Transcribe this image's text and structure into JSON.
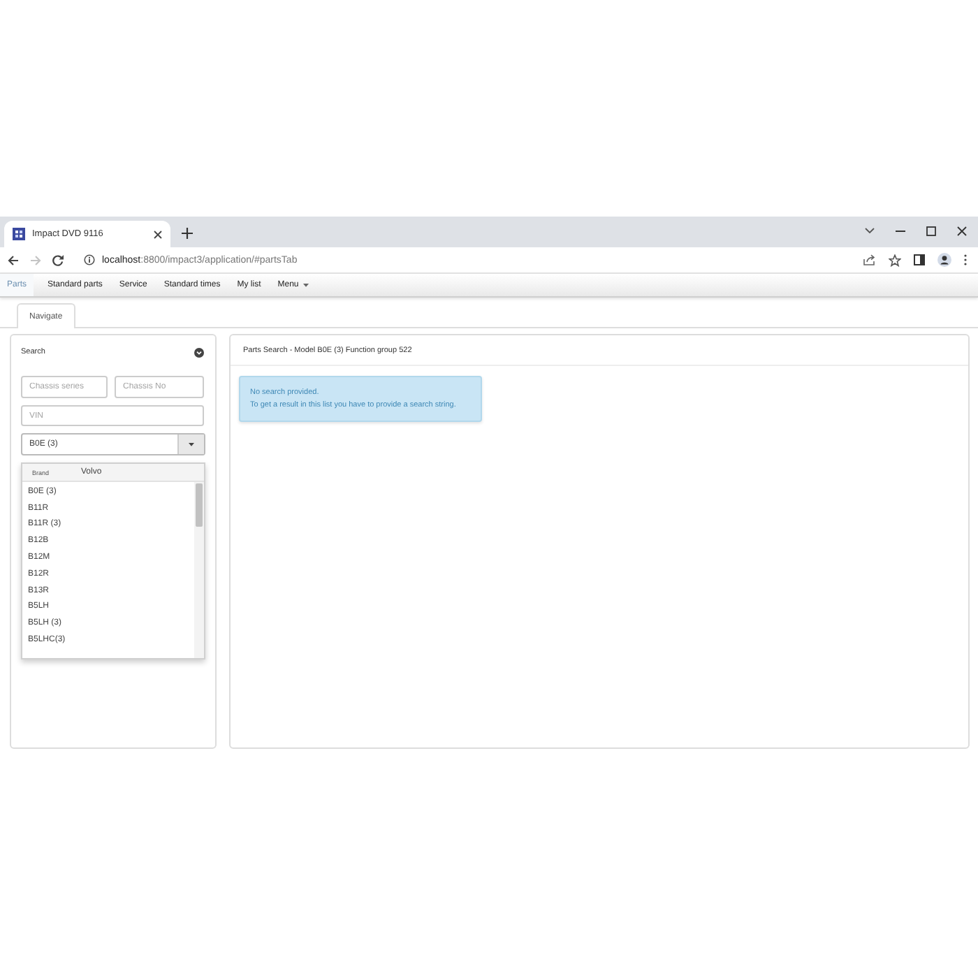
{
  "browser": {
    "tabs": [
      {
        "title": "Impact DVD 9116",
        "selected": true
      }
    ],
    "nav_buttons": [
      {
        "kind": "back",
        "disabled": false
      },
      {
        "kind": "forward",
        "disabled": true
      },
      {
        "kind": "reload",
        "disabled": false
      }
    ],
    "url": {
      "host": "localhost",
      "rest": ":8800/impact3/application/#partsTab"
    }
  },
  "app_nav": {
    "tabs": [
      {
        "label": "Parts",
        "kind": "tab",
        "selected": true
      },
      {
        "label": "Standard parts",
        "kind": "tab",
        "selected": false
      },
      {
        "label": "Service",
        "kind": "tab",
        "selected": false
      },
      {
        "label": "Standard times",
        "kind": "tab",
        "selected": false
      },
      {
        "label": "My list",
        "kind": "tab",
        "selected": false
      },
      {
        "label": "Menu",
        "kind": "menu",
        "selected": false
      }
    ]
  },
  "sub_tabs": [
    {
      "label": "Navigate",
      "selected": true
    }
  ],
  "search_panel": {
    "title": "Search",
    "fields": [
      {
        "placeholder": "Chassis series"
      },
      {
        "placeholder": "Chassis No"
      },
      {
        "placeholder": "VIN"
      }
    ],
    "model_select": {
      "value": "B0E (3)",
      "expanded": true
    },
    "dropdown": {
      "filter_label": "Brand",
      "filter_value": "Volvo",
      "options": [
        {
          "label": "B0E (3)",
          "selected": false
        },
        {
          "label": "B11R",
          "selected": false
        },
        {
          "label": "B11R (3)",
          "selected": false
        },
        {
          "label": "B12B",
          "selected": false
        },
        {
          "label": "B12M",
          "selected": false
        },
        {
          "label": "B12R",
          "selected": false
        },
        {
          "label": "B13R",
          "selected": false
        },
        {
          "label": "B5LH",
          "selected": false
        },
        {
          "label": "B5LH (3)",
          "selected": false
        },
        {
          "label": "B5LHC(3)",
          "selected": false
        }
      ]
    }
  },
  "results_panel": {
    "title": "Parts Search - Model B0E (3) Function group 522",
    "alert": {
      "kind": "info",
      "lines": [
        "No search provided.",
        "To get a result in this list you have to provide a search string."
      ]
    }
  }
}
